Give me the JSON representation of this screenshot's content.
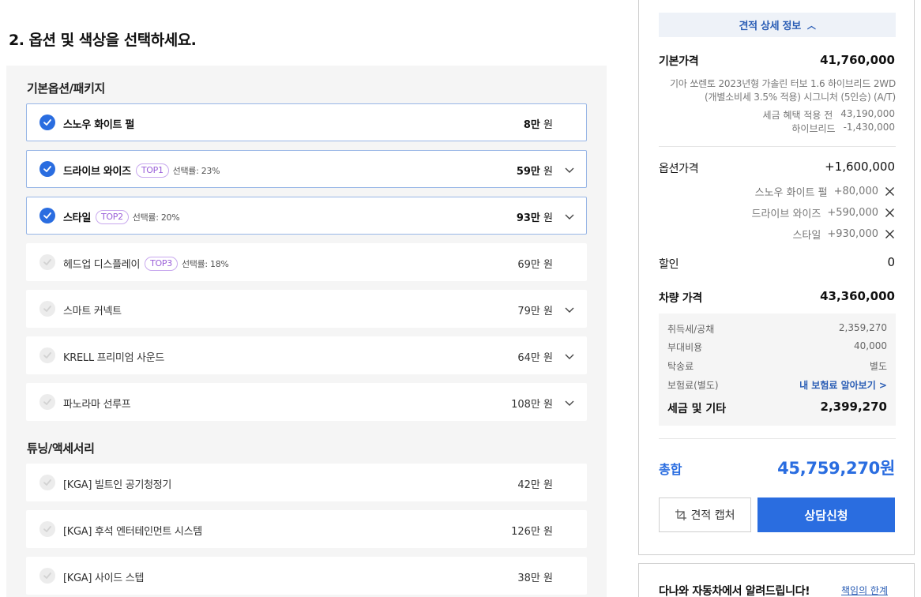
{
  "page": {
    "section_title": "2. 옵션 및 색상을 선택하세요."
  },
  "options": {
    "group_basic": "기본옵션/패키지",
    "group_tuning": "튜닝/액세서리",
    "basic_items": [
      {
        "name": "스노우 화이트 펄",
        "price_num": "8만",
        "unit": " 원",
        "selected": true,
        "badge": "",
        "rate": "",
        "expand": false
      },
      {
        "name": "드라이브 와이즈",
        "price_num": "59만",
        "unit": " 원",
        "selected": true,
        "badge": "TOP1",
        "rate": "선택률: 23%",
        "expand": true
      },
      {
        "name": "스타일",
        "price_num": "93만",
        "unit": " 원",
        "selected": true,
        "badge": "TOP2",
        "rate": "선택률: 20%",
        "expand": true
      },
      {
        "name": "헤드업 디스플레이",
        "price_num": "69만",
        "unit": " 원",
        "selected": false,
        "badge": "TOP3",
        "rate": "선택률: 18%",
        "expand": false
      },
      {
        "name": "스마트 커넥트",
        "price_num": "79만",
        "unit": " 원",
        "selected": false,
        "badge": "",
        "rate": "",
        "expand": true
      },
      {
        "name": "KRELL 프리미엄 사운드",
        "price_num": "64만",
        "unit": " 원",
        "selected": false,
        "badge": "",
        "rate": "",
        "expand": true
      },
      {
        "name": "파노라마 선루프",
        "price_num": "108만",
        "unit": " 원",
        "selected": false,
        "badge": "",
        "rate": "",
        "expand": true
      }
    ],
    "tuning_items": [
      {
        "name": "[KGA] 빌트인 공기청정기",
        "price_num": "42만",
        "unit": " 원",
        "selected": false,
        "badge": "",
        "rate": "",
        "expand": false
      },
      {
        "name": "[KGA] 후석 엔터테인먼트 시스템",
        "price_num": "126만",
        "unit": " 원",
        "selected": false,
        "badge": "",
        "rate": "",
        "expand": false
      },
      {
        "name": "[KGA] 사이드 스텝",
        "price_num": "38만",
        "unit": " 원",
        "selected": false,
        "badge": "",
        "rate": "",
        "expand": false
      }
    ]
  },
  "summary": {
    "toggle_label": "견적 상세 정보",
    "base_label": "기본가격",
    "base_value": "41,760,000",
    "base_desc": "기아 쏘렌토 2023년형 가솔린 터보 1.6 하이브리드 2WD (개별소비세 3.5% 적용) 시그니처 (5인승) (A/T)",
    "pre_tax_label": "세금 혜택 적용 전",
    "pre_tax_value": "43,190,000",
    "hybrid_label": "하이브리드",
    "hybrid_value": "-1,430,000",
    "option_label": "옵션가격",
    "option_value": "+1,600,000",
    "option_lines": [
      {
        "name": "스노우 화이트 펄",
        "value": "+80,000"
      },
      {
        "name": "드라이브 와이즈",
        "value": "+590,000"
      },
      {
        "name": "스타일",
        "value": "+930,000"
      }
    ],
    "discount_label": "할인",
    "discount_value": "0",
    "car_price_label": "차량 가격",
    "car_price_value": "43,360,000",
    "tax": {
      "acq_label": "취득세/공채",
      "acq_value": "2,359,270",
      "extra_label": "부대비용",
      "extra_value": "40,000",
      "delivery_label": "탁송료",
      "delivery_value": "별도",
      "insurance_label": "보험료(별도)",
      "insurance_link": "내 보험료 알아보기 >",
      "total_label": "세금 및 기타",
      "total_value": "2,399,270"
    },
    "grand_label": "총합",
    "grand_value": "45,759,270원",
    "capture_label": "견적 캡처",
    "consult_label": "상담신청"
  },
  "notice": {
    "title": "다나와 자동차에서 알려드립니다!",
    "link": "책임의 한계"
  },
  "colors": {
    "accent": "#2a6de0",
    "badge": "#9a5fd8",
    "link": "#2a5db5"
  }
}
